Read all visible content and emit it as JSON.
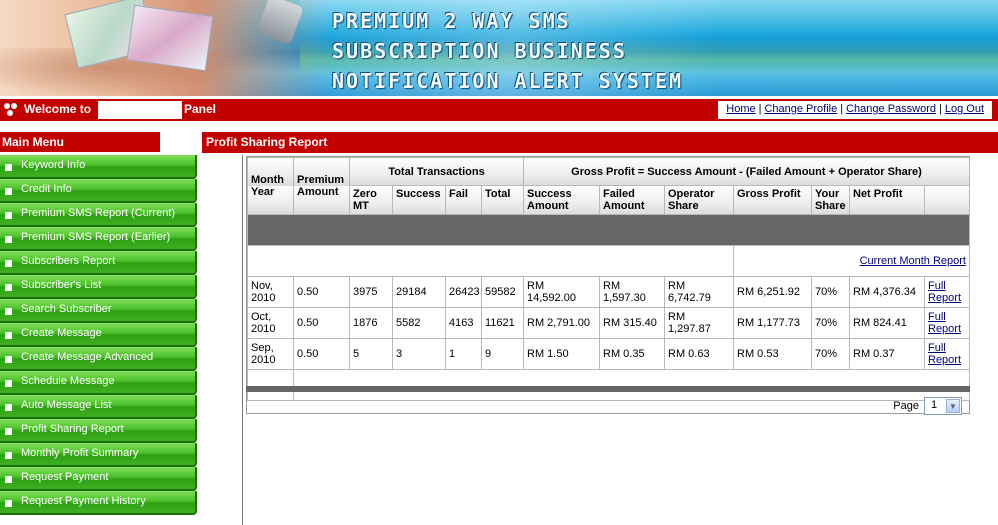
{
  "banner": {
    "title_lines": [
      "PREMIUM 2 WAY SMS",
      "SUBSCRIPTION BUSINESS",
      "NOTIFICATION ALERT SYSTEM"
    ]
  },
  "welcome": {
    "prefix": "Welcome to",
    "suffix": "Panel"
  },
  "top_links": [
    "Home",
    "Change Profile",
    "Change Password",
    "Log Out"
  ],
  "menu": {
    "header": "Main Menu",
    "items": [
      "Keyword Info",
      "Credit Info",
      "Premium SMS Report (Current)",
      "Premium SMS Report (Earlier)",
      "Subscribers Report",
      "Subscriber's List",
      "Search Subscriber",
      "Create Message",
      "Create Message Advanced",
      "Schedule Message",
      "Auto Message List",
      "Profit Sharing Report",
      "Monthly Profit Summary",
      "Request Payment",
      "Request Payment History"
    ]
  },
  "report": {
    "header": "Profit Sharing Report",
    "col_month_year": "Month Year",
    "col_premium_amount": "Premium Amount",
    "group_total_transactions": "Total Transactions",
    "group_gross_profit": "Gross Profit = Success Amount - (Failed Amount + Operator Share)",
    "sub_headers": [
      "Zero MT",
      "Success",
      "Fail",
      "Total",
      "Success Amount",
      "Failed Amount",
      "Operator Share",
      "Gross Profit",
      "Your Share",
      "Net Profit"
    ],
    "current_month_link": "Current Month Report",
    "rows": [
      {
        "month": "Nov, 2010",
        "premium": "0.50",
        "zero_mt": "3975",
        "success": "29184",
        "fail": "26423",
        "total": "59582",
        "success_amount": "RM 14,592.00",
        "failed_amount": "RM 1,597.30",
        "operator_share": "RM 6,742.79",
        "gross_profit": "RM 6,251.92",
        "your_share": "70%",
        "net_profit": "RM 4,376.34",
        "link": "Full Report"
      },
      {
        "month": "Oct, 2010",
        "premium": "0.50",
        "zero_mt": "1876",
        "success": "5582",
        "fail": "4163",
        "total": "11621",
        "success_amount": "RM 2,791.00",
        "failed_amount": "RM 315.40",
        "operator_share": "RM 1,297.87",
        "gross_profit": "RM 1,177.73",
        "your_share": "70%",
        "net_profit": "RM 824.41",
        "link": "Full Report"
      },
      {
        "month": "Sep, 2010",
        "premium": "0.50",
        "zero_mt": "5",
        "success": "3",
        "fail": "1",
        "total": "9",
        "success_amount": "RM 1.50",
        "failed_amount": "RM 0.35",
        "operator_share": "RM 0.63",
        "gross_profit": "RM 0.53",
        "your_share": "70%",
        "net_profit": "RM 0.37",
        "link": "Full Report"
      }
    ]
  },
  "pager": {
    "label": "Page",
    "selected": "1"
  }
}
